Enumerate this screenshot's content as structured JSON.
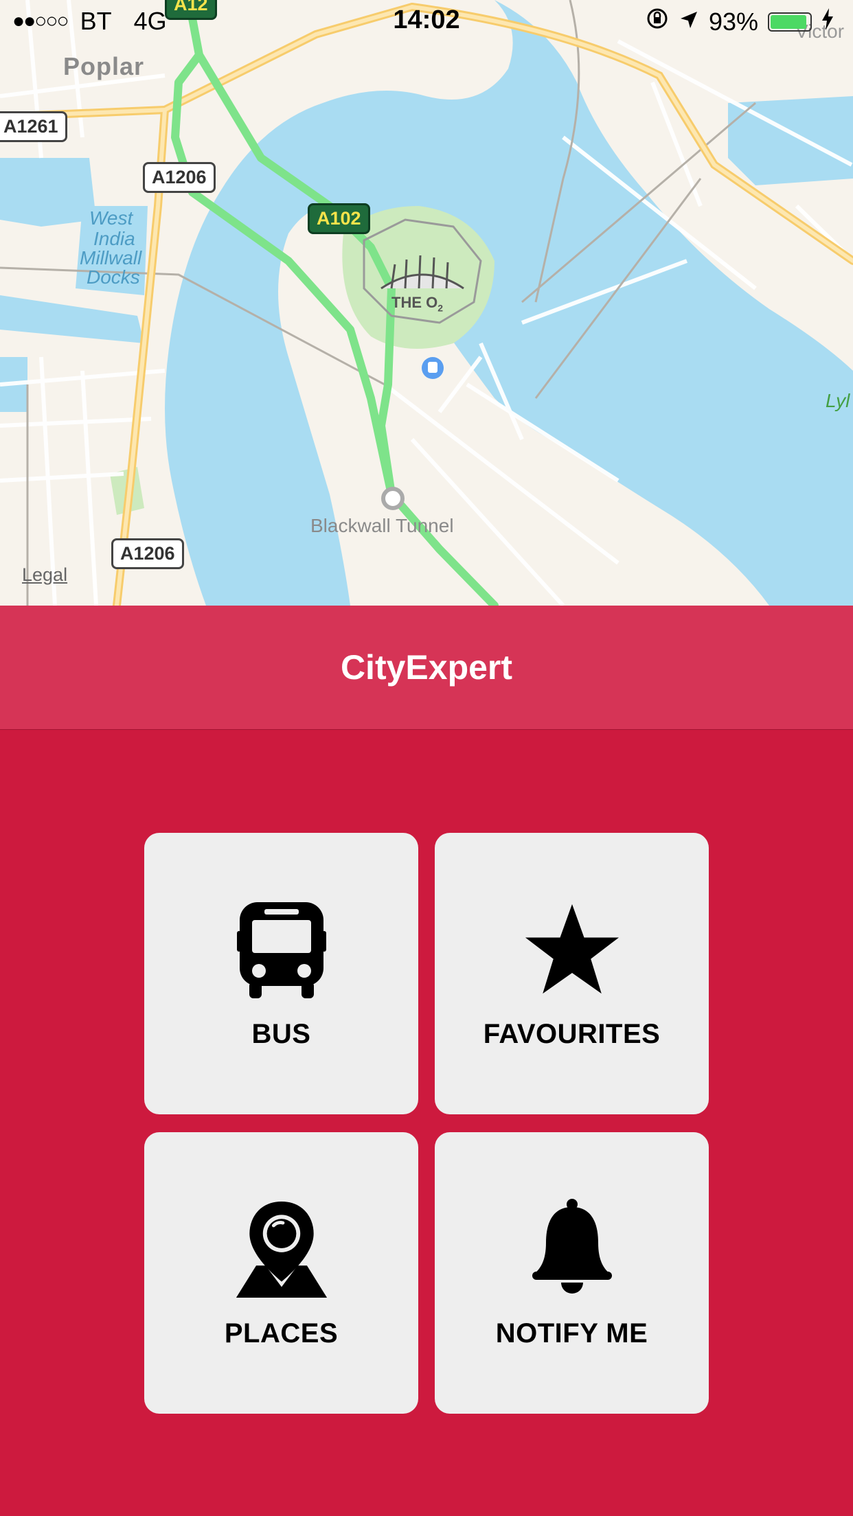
{
  "status_bar": {
    "signal": "●●○○○",
    "carrier": "BT",
    "network": "4G",
    "time": "14:02",
    "battery_percent": "93%",
    "battery_level": 0.93,
    "icons": [
      "orientation-lock-icon",
      "location-arrow-icon",
      "battery-icon",
      "charging-bolt-icon"
    ]
  },
  "map": {
    "labels": {
      "poplar": "Poplar",
      "west_india": "West",
      "india": "India",
      "millwall": "Millwall",
      "docks": "Docks",
      "the_o2": "THE O",
      "o2_sub": "2",
      "blackwall": "Blackwall Tunnel",
      "victoria": "Victor",
      "lyle": "Lyl"
    },
    "roads": [
      "A12",
      "A1261",
      "A1206",
      "A102",
      "A1206"
    ],
    "legal": "Legal",
    "colors": {
      "water": "#a9dcf2",
      "land": "#f7f3ec",
      "park": "#cdeabe",
      "route": "#7ee38a",
      "major_road": "#fcdc8b"
    }
  },
  "app": {
    "title": "CityExpert",
    "colors": {
      "header": "#d63456",
      "background": "#cd1a3e",
      "tile": "#eeeeee"
    }
  },
  "menu": [
    {
      "label": "BUS",
      "icon": "bus-icon"
    },
    {
      "label": "FAVOURITES",
      "icon": "star-icon"
    },
    {
      "label": "PLACES",
      "icon": "map-pin-icon"
    },
    {
      "label": "NOTIFY ME",
      "icon": "bell-icon"
    }
  ]
}
